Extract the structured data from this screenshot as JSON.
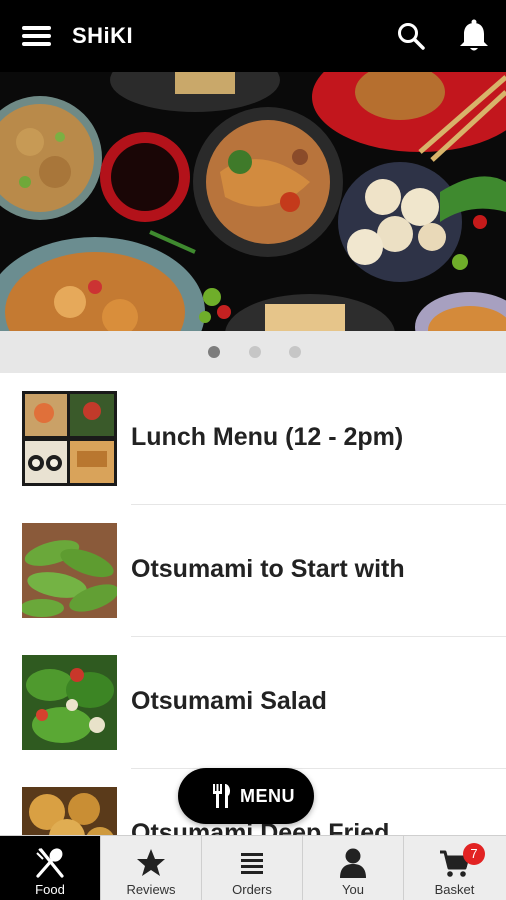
{
  "header": {
    "title": "SHiKI",
    "menu_icon": "hamburger-menu-icon",
    "search_icon": "search-icon",
    "notifications_icon": "bell-icon"
  },
  "carousel": {
    "slide_count": 3,
    "active_index": 0
  },
  "categories": [
    {
      "label": "Lunch Menu (12 - 2pm)"
    },
    {
      "label": "Otsumami to Start with"
    },
    {
      "label": "Otsumami Salad"
    },
    {
      "label": "Otsumami Deep Fried"
    }
  ],
  "menu_button": {
    "label": "MENU",
    "icon": "fork-knife-icon"
  },
  "tabbar": {
    "tabs": [
      {
        "label": "Food",
        "icon": "fork-spoon-icon",
        "active": true
      },
      {
        "label": "Reviews",
        "icon": "star-icon",
        "active": false
      },
      {
        "label": "Orders",
        "icon": "list-icon",
        "active": false
      },
      {
        "label": "You",
        "icon": "person-icon",
        "active": false
      },
      {
        "label": "Basket",
        "icon": "cart-icon",
        "active": false
      }
    ],
    "basket_count": "7"
  },
  "colors": {
    "topbar": "#000000",
    "tab_active": "#000000",
    "badge": "#e22323",
    "dots_bar": "#e7e7e7"
  }
}
